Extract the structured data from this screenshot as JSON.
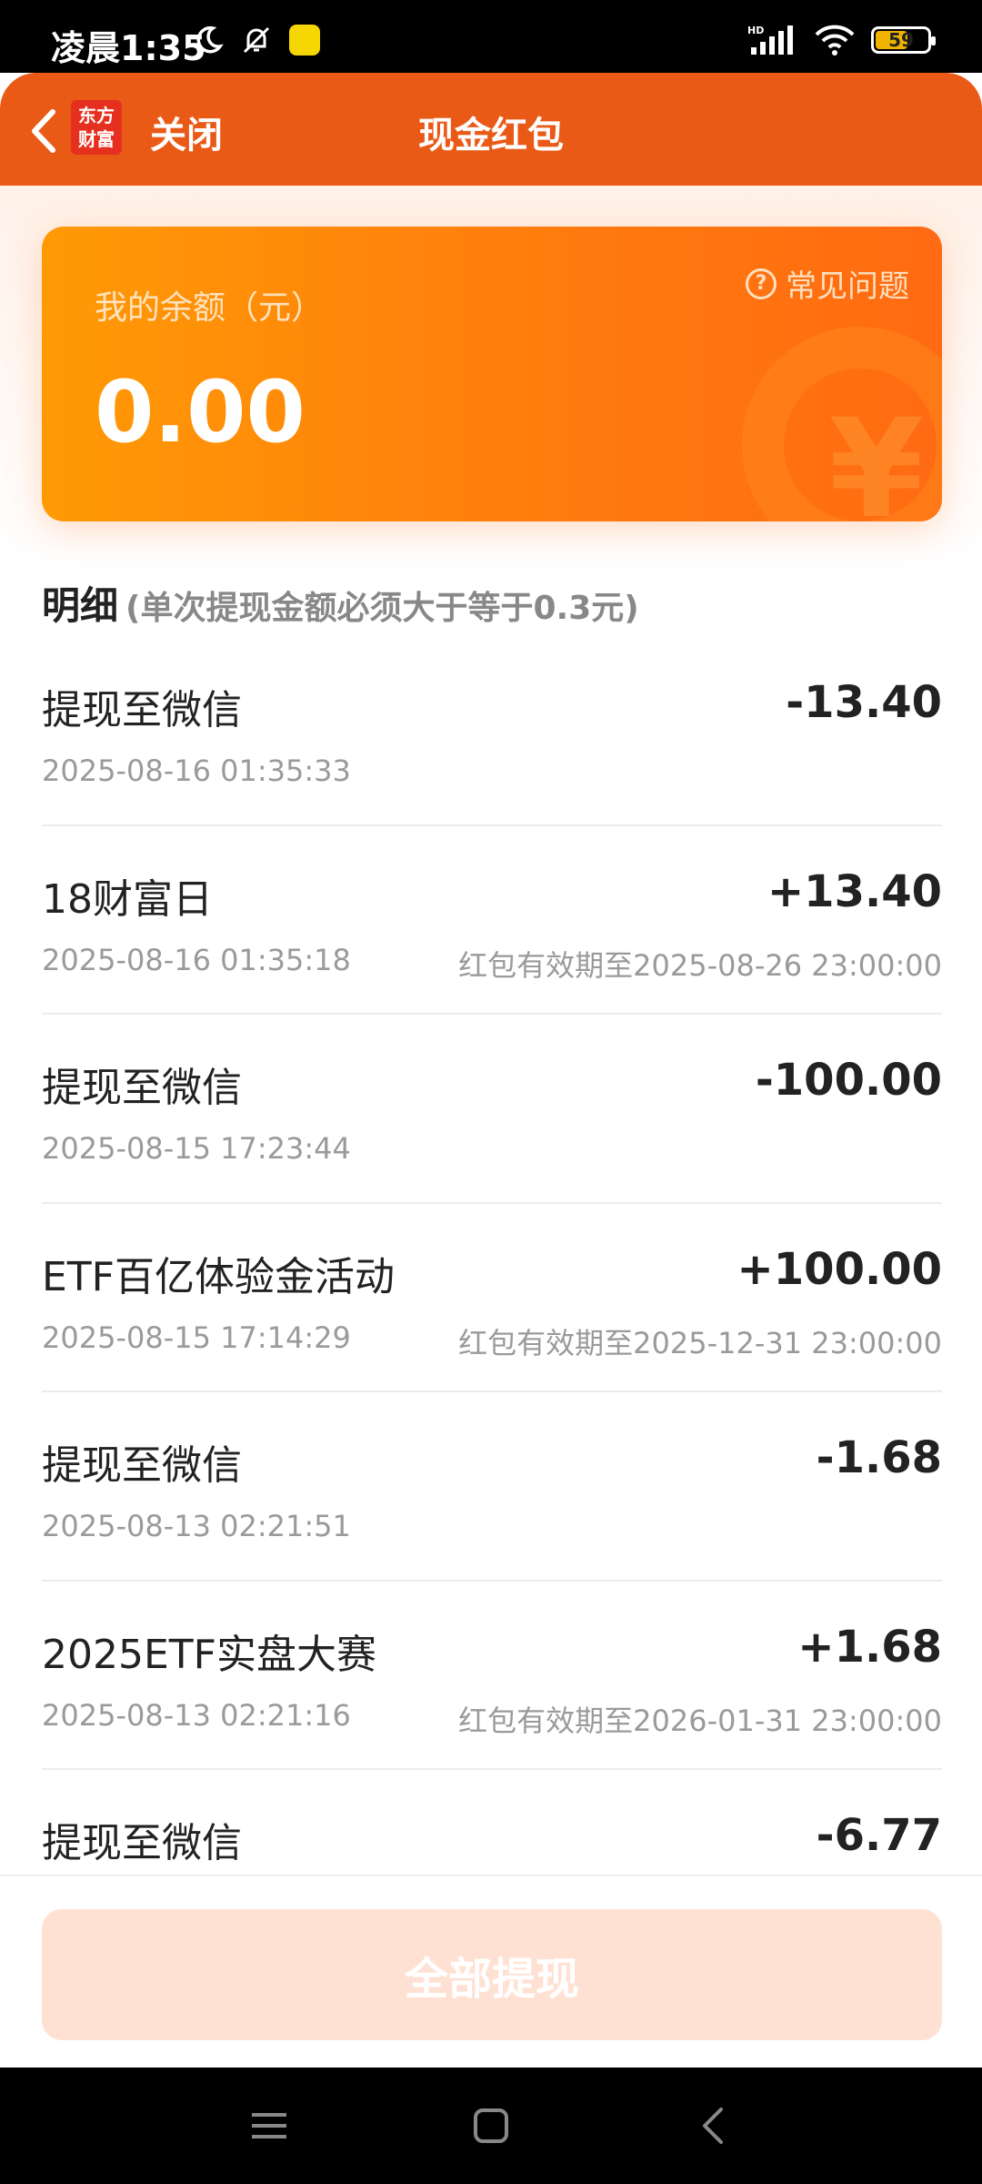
{
  "status_bar": {
    "time": "凌晨1:35",
    "battery": "59",
    "network": "HD"
  },
  "header": {
    "logo_text_line1": "东方",
    "logo_text_line2": "财富",
    "close_label": "关闭",
    "title": "现金红包"
  },
  "balance_card": {
    "label": "我的余额（元）",
    "value": "0.00",
    "faq_label": "常见问题"
  },
  "detail": {
    "title": "明细",
    "note": "(单次提现金额必须大于等于0.3元)"
  },
  "transactions": [
    {
      "title": "提现至微信",
      "amount": "-13.40",
      "time": "2025-08-16 01:35:33",
      "expiry": ""
    },
    {
      "title": "18财富日",
      "amount": "+13.40",
      "time": "2025-08-16 01:35:18",
      "expiry": "红包有效期至2025-08-26 23:00:00"
    },
    {
      "title": "提现至微信",
      "amount": "-100.00",
      "time": "2025-08-15 17:23:44",
      "expiry": ""
    },
    {
      "title": "ETF百亿体验金活动",
      "amount": "+100.00",
      "time": "2025-08-15 17:14:29",
      "expiry": "红包有效期至2025-12-31 23:00:00"
    },
    {
      "title": "提现至微信",
      "amount": "-1.68",
      "time": "2025-08-13 02:21:51",
      "expiry": ""
    },
    {
      "title": "2025ETF实盘大赛",
      "amount": "+1.68",
      "time": "2025-08-13 02:21:16",
      "expiry": "红包有效期至2026-01-31 23:00:00"
    },
    {
      "title": "提现至微信",
      "amount": "-6.77",
      "time": "",
      "expiry": ""
    }
  ],
  "footer": {
    "withdraw_all_label": "全部提现"
  },
  "icons": {
    "back": "chevron-left-icon",
    "faq": "question-circle-icon",
    "menu": "menu-icon",
    "home": "home-square-icon",
    "nav_back": "nav-back-icon"
  },
  "colors": {
    "header_bg": "#ea5a17",
    "card_start": "#ff9a05",
    "card_end": "#ff6a12",
    "button_disabled": "#ffe1d3"
  }
}
